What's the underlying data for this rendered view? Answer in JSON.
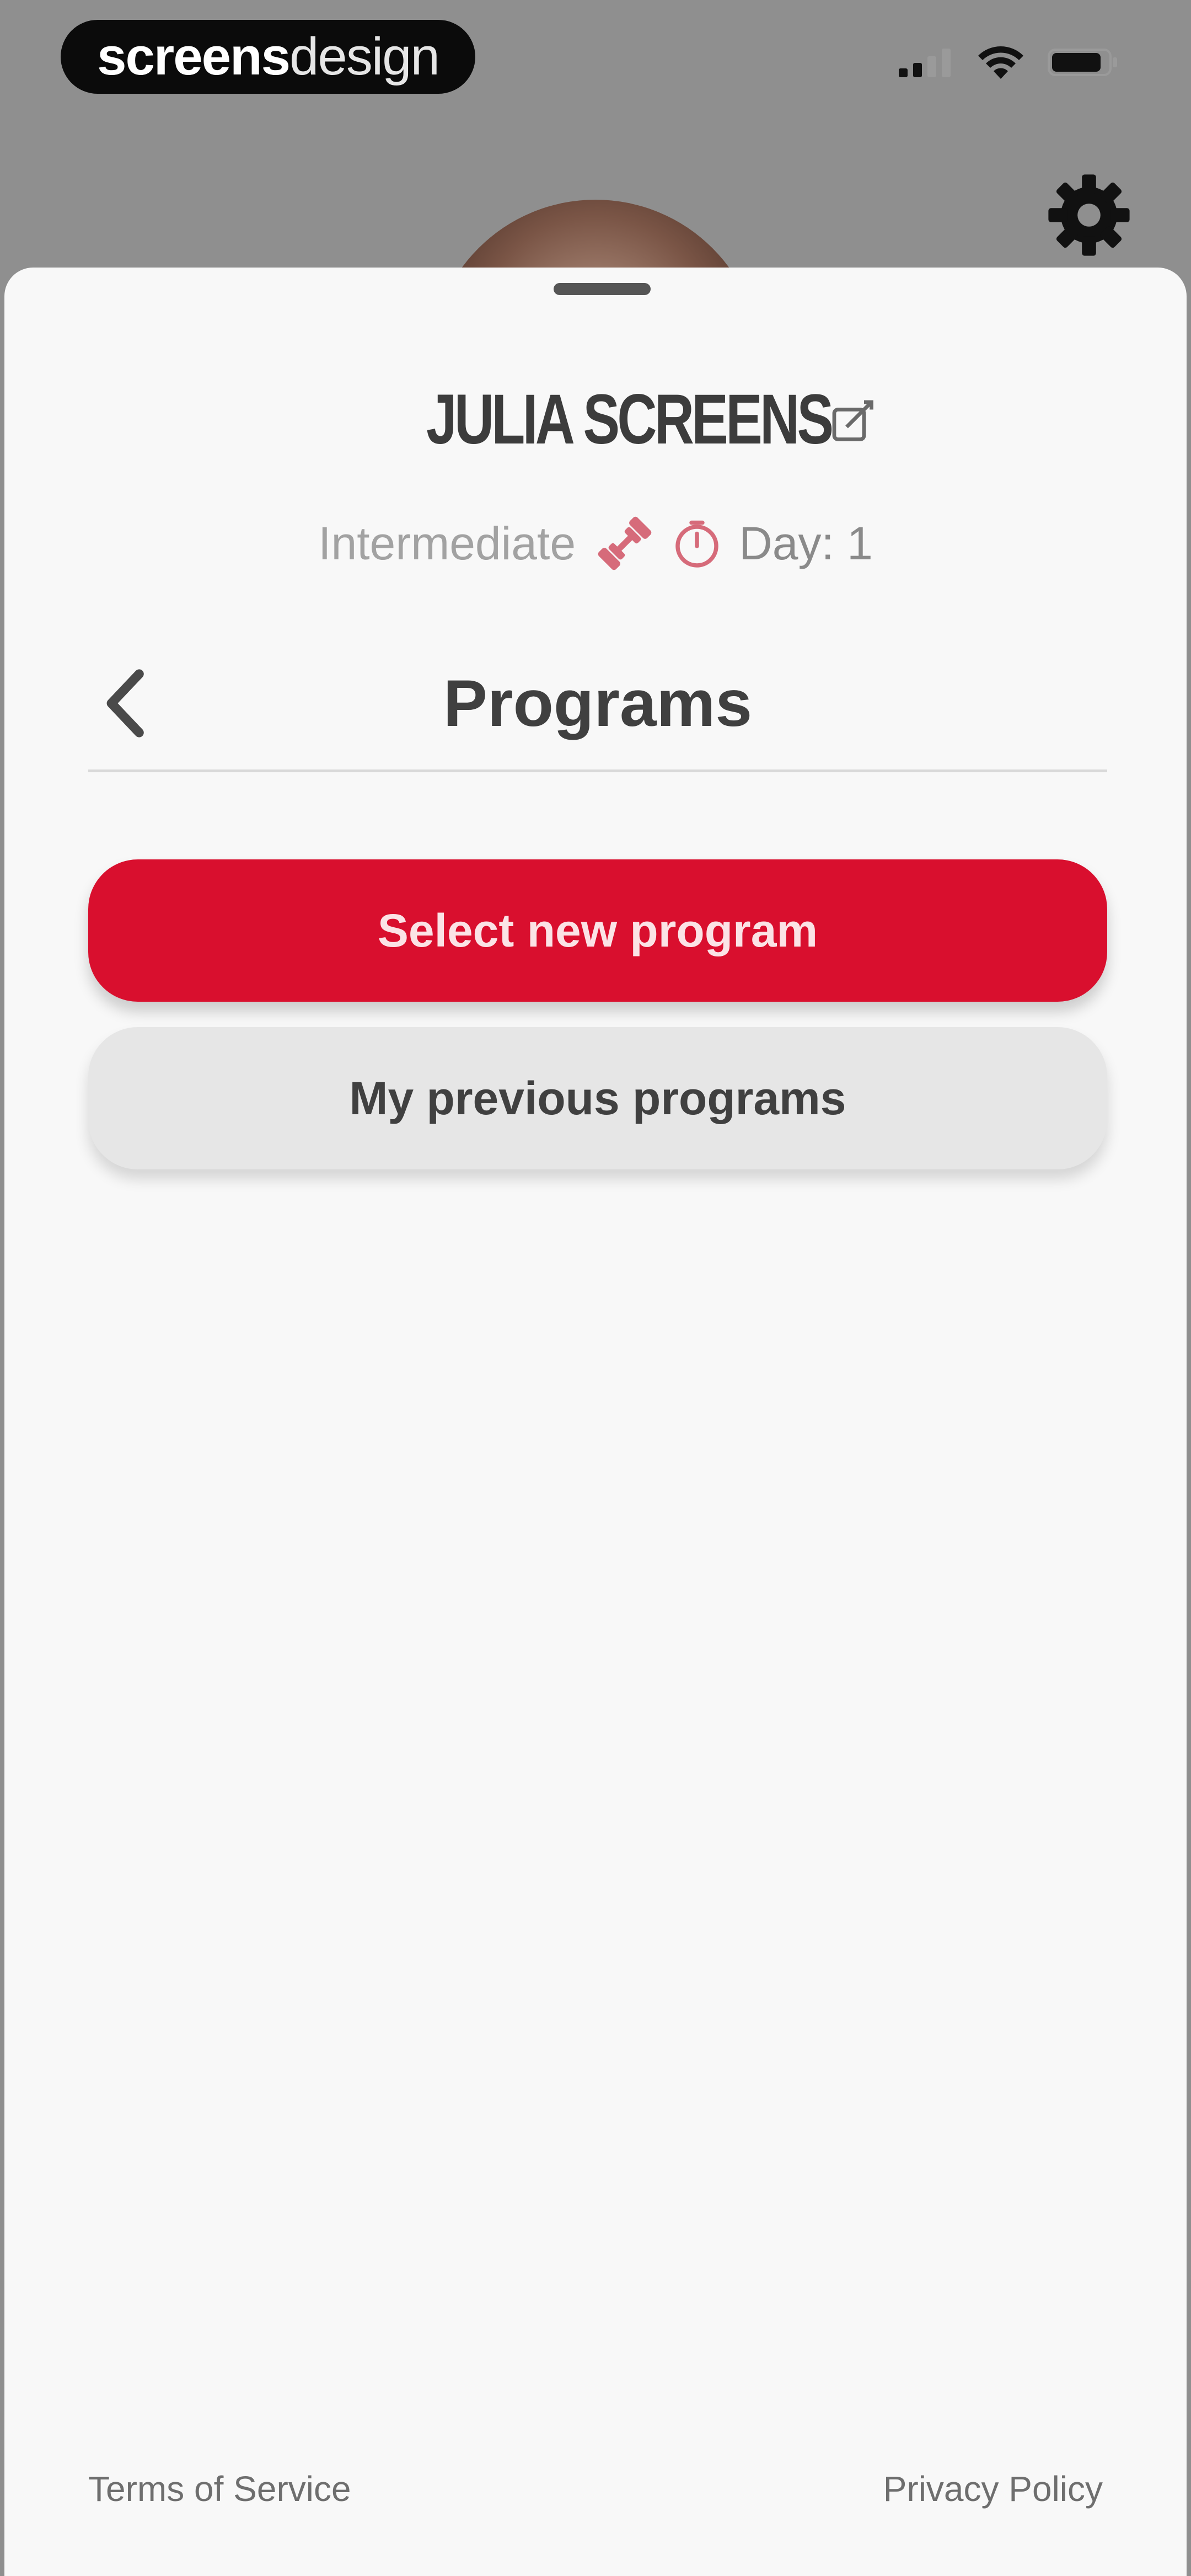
{
  "status_bar": {
    "brand_bold": "screens",
    "brand_light": "design",
    "icons": [
      "cellular-signal-icon",
      "wifi-icon",
      "battery-icon"
    ]
  },
  "header": {
    "settings_icon": "gear-icon"
  },
  "profile": {
    "name": "JULIA SCREENS",
    "level": "Intermediate",
    "day": "Day: 1",
    "icons": {
      "edit": "edit-icon",
      "level": "dumbbell-icon",
      "day": "timer-icon"
    }
  },
  "programs": {
    "title": "Programs",
    "back_icon": "chevron-left-icon",
    "select_new_label": "Select new program",
    "previous_label": "My previous programs"
  },
  "footer": {
    "terms": "Terms of Service",
    "privacy": "Privacy Policy"
  },
  "colors": {
    "accent": "#d90f2e",
    "sheet_background": "#f8f8f8",
    "backdrop": "#8f8f8f",
    "secondary_button": "#e6e6e6",
    "icon_accent": "#d66b7a"
  }
}
